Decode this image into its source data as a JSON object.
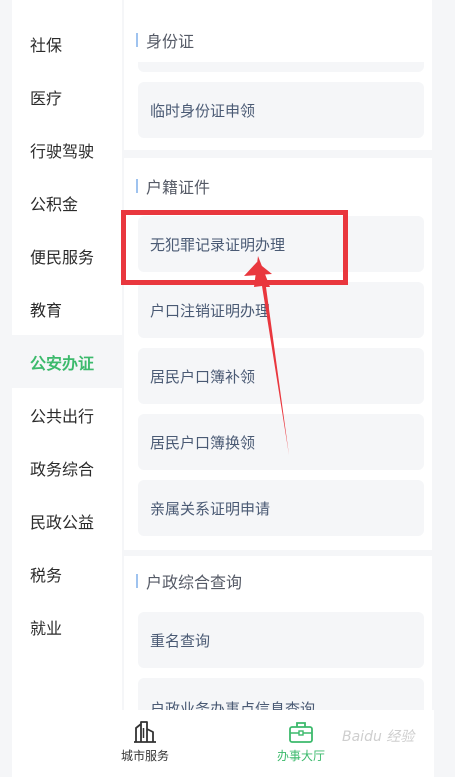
{
  "sidebar": {
    "items": [
      {
        "label": "社保"
      },
      {
        "label": "医疗"
      },
      {
        "label": "行驶驾驶"
      },
      {
        "label": "公积金"
      },
      {
        "label": "便民服务"
      },
      {
        "label": "教育"
      },
      {
        "label": "公安办证"
      },
      {
        "label": "公共出行"
      },
      {
        "label": "政务综合"
      },
      {
        "label": "民政公益"
      },
      {
        "label": "税务"
      },
      {
        "label": "就业"
      }
    ],
    "active_index": 6,
    "active_color": "#3cba6c"
  },
  "sections": [
    {
      "title": "身份证",
      "items": [
        {
          "label": "临时身份证申领"
        }
      ]
    },
    {
      "title": "户籍证件",
      "items": [
        {
          "label": "无犯罪记录证明办理"
        },
        {
          "label": "户口注销证明办理"
        },
        {
          "label": "居民户口簿补领"
        },
        {
          "label": "居民户口簿换领"
        },
        {
          "label": "亲属关系证明申请"
        }
      ]
    },
    {
      "title": "户政综合查询",
      "items": [
        {
          "label": "重名查询"
        },
        {
          "label": "户政业务办事点信息查询"
        }
      ]
    }
  ],
  "tabbar": {
    "tabs": [
      {
        "label": "城市服务",
        "icon": "city-building-icon"
      },
      {
        "label": "办事大厅",
        "icon": "briefcase-icon"
      }
    ],
    "active_index": 1
  },
  "annotation_color": "#e9373e",
  "watermark": "Baidu 经验"
}
